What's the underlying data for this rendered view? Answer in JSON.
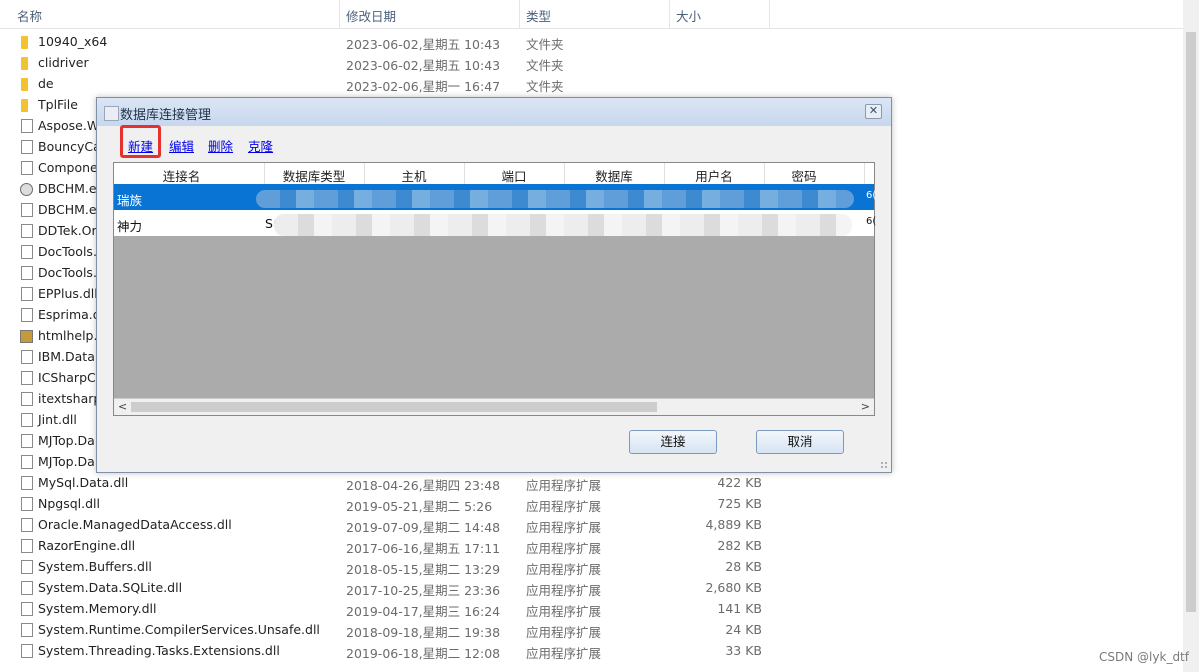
{
  "explorer": {
    "columns": {
      "name": "名称",
      "modified": "修改日期",
      "type": "类型",
      "size": "大小"
    },
    "rows": [
      {
        "icon": "folder",
        "name": "10940_x64",
        "date": "2023-06-02,星期五 10:43",
        "type": "文件夹",
        "size": ""
      },
      {
        "icon": "folder",
        "name": "clidriver",
        "date": "2023-06-02,星期五 10:43",
        "type": "文件夹",
        "size": ""
      },
      {
        "icon": "folder",
        "name": "de",
        "date": "2023-02-06,星期一 16:47",
        "type": "文件夹",
        "size": ""
      },
      {
        "icon": "folder",
        "name": "TplFile",
        "date": "",
        "type": "",
        "size": ""
      },
      {
        "icon": "file",
        "name": "Aspose.W",
        "date": "",
        "type": "",
        "size": ""
      },
      {
        "icon": "file",
        "name": "BouncyCa",
        "date": "",
        "type": "",
        "size": ""
      },
      {
        "icon": "file",
        "name": "Compone",
        "date": "",
        "type": "",
        "size": ""
      },
      {
        "icon": "exe",
        "name": "DBCHM.e",
        "date": "",
        "type": "",
        "size": ""
      },
      {
        "icon": "file",
        "name": "DBCHM.e",
        "date": "",
        "type": "",
        "size": ""
      },
      {
        "icon": "file",
        "name": "DDTek.Or",
        "date": "",
        "type": "",
        "size": ""
      },
      {
        "icon": "file",
        "name": "DocTools.",
        "date": "",
        "type": "",
        "size": ""
      },
      {
        "icon": "file",
        "name": "DocTools.",
        "date": "",
        "type": "",
        "size": ""
      },
      {
        "icon": "file",
        "name": "EPPlus.dll",
        "date": "",
        "type": "",
        "size": ""
      },
      {
        "icon": "file",
        "name": "Esprima.d",
        "date": "",
        "type": "",
        "size": ""
      },
      {
        "icon": "app",
        "name": "htmlhelp.e",
        "date": "",
        "type": "",
        "size": ""
      },
      {
        "icon": "file",
        "name": "IBM.Data.",
        "date": "",
        "type": "",
        "size": ""
      },
      {
        "icon": "file",
        "name": "ICSharpCo",
        "date": "",
        "type": "",
        "size": ""
      },
      {
        "icon": "file",
        "name": "itextsharp",
        "date": "",
        "type": "",
        "size": ""
      },
      {
        "icon": "file",
        "name": "Jint.dll",
        "date": "",
        "type": "",
        "size": ""
      },
      {
        "icon": "file",
        "name": "MJTop.Da",
        "date": "",
        "type": "",
        "size": ""
      },
      {
        "icon": "file",
        "name": "MJTop.Da",
        "date": "",
        "type": "",
        "size": ""
      },
      {
        "icon": "file",
        "name": "MySql.Data.dll",
        "date": "2018-04-26,星期四 23:48",
        "type": "应用程序扩展",
        "size": "422 KB"
      },
      {
        "icon": "file",
        "name": "Npgsql.dll",
        "date": "2019-05-21,星期二 5:26",
        "type": "应用程序扩展",
        "size": "725 KB"
      },
      {
        "icon": "file",
        "name": "Oracle.ManagedDataAccess.dll",
        "date": "2019-07-09,星期二 14:48",
        "type": "应用程序扩展",
        "size": "4,889 KB"
      },
      {
        "icon": "file",
        "name": "RazorEngine.dll",
        "date": "2017-06-16,星期五 17:11",
        "type": "应用程序扩展",
        "size": "282 KB"
      },
      {
        "icon": "file",
        "name": "System.Buffers.dll",
        "date": "2018-05-15,星期二 13:29",
        "type": "应用程序扩展",
        "size": "28 KB"
      },
      {
        "icon": "file",
        "name": "System.Data.SQLite.dll",
        "date": "2017-10-25,星期三 23:36",
        "type": "应用程序扩展",
        "size": "2,680 KB"
      },
      {
        "icon": "file",
        "name": "System.Memory.dll",
        "date": "2019-04-17,星期三 16:24",
        "type": "应用程序扩展",
        "size": "141 KB"
      },
      {
        "icon": "file",
        "name": "System.Runtime.CompilerServices.Unsafe.dll",
        "date": "2018-09-18,星期二 19:38",
        "type": "应用程序扩展",
        "size": "24 KB"
      },
      {
        "icon": "file",
        "name": "System.Threading.Tasks.Extensions.dll",
        "date": "2019-06-18,星期二 12:08",
        "type": "应用程序扩展",
        "size": "33 KB"
      }
    ]
  },
  "dialog": {
    "title": "数据库连接管理",
    "close_label": "✕",
    "toolbar": {
      "new": "新建",
      "edit": "编辑",
      "delete": "删除",
      "clone": "克隆"
    },
    "columns": [
      "连接名",
      "数据库类型",
      "主机",
      "端口",
      "数据库",
      "用户名",
      "密码"
    ],
    "rows": [
      {
        "name": "瑞族",
        "selected": true,
        "partial_type": "",
        "tail": "6("
      },
      {
        "name": "神力",
        "selected": false,
        "partial_type": "S(",
        "tail": "6("
      }
    ],
    "buttons": {
      "connect": "连接",
      "cancel": "取消"
    }
  },
  "watermark": "CSDN @lyk_dtf"
}
